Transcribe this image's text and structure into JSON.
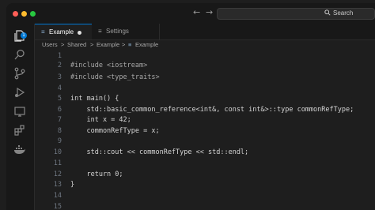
{
  "titlebar": {
    "back_arrow": "←",
    "forward_arrow": "→",
    "search_label": "Search",
    "traffic_lights": [
      "#ff5f57",
      "#febc2e",
      "#28c840"
    ]
  },
  "activity_bar": {
    "items": [
      "explorer-icon",
      "search-icon",
      "source-control-icon",
      "run-debug-icon",
      "remote-explorer-icon",
      "extensions-icon",
      "docker-icon"
    ],
    "explorer_badge": "1",
    "accent": "#0078d4"
  },
  "tabs": [
    {
      "label": "Example",
      "icon": "≡",
      "modified": true
    },
    {
      "label": "Settings",
      "icon": "≡"
    }
  ],
  "breadcrumb": {
    "parts": [
      "Users",
      "Shared",
      "Example",
      "Example"
    ],
    "separator": ">",
    "file_icon": "≡"
  },
  "editor": {
    "lines": [
      {
        "n": "1",
        "text": ""
      },
      {
        "n": "2",
        "text": "#include <iostream>"
      },
      {
        "n": "3",
        "text": "#include <type_traits>"
      },
      {
        "n": "4",
        "text": ""
      },
      {
        "n": "5",
        "text": "int main() {"
      },
      {
        "n": "6",
        "text": "    std::basic_common_reference<int&, const int&>::type commonRefType;"
      },
      {
        "n": "7",
        "text": "    int x = 42;"
      },
      {
        "n": "8",
        "text": "    commonRefType = x;"
      },
      {
        "n": "9",
        "text": ""
      },
      {
        "n": "10",
        "text": "    std::cout << commonRefType << std::endl;"
      },
      {
        "n": "11",
        "text": ""
      },
      {
        "n": "12",
        "text": "    return 0;"
      },
      {
        "n": "13",
        "text": "}"
      },
      {
        "n": "14",
        "text": ""
      },
      {
        "n": "15",
        "text": ""
      }
    ]
  }
}
